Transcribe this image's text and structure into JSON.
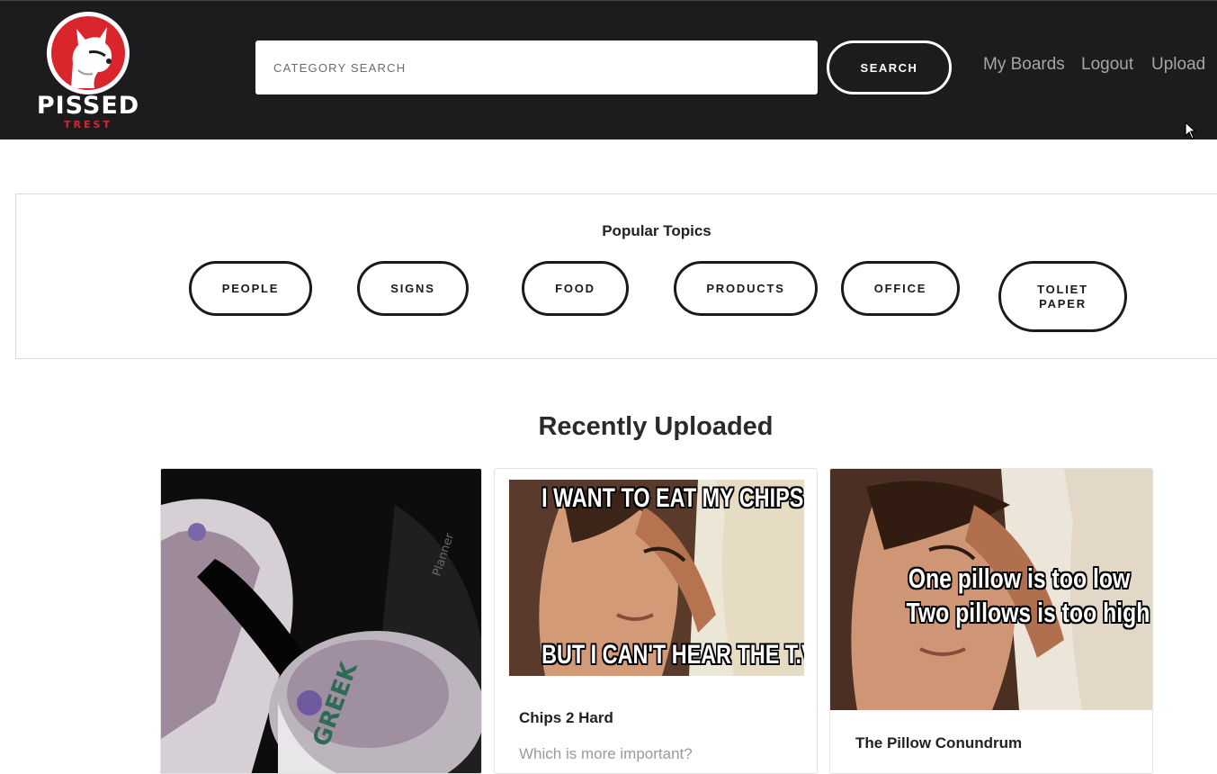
{
  "header": {
    "logo": {
      "word": "PISSED",
      "sub": "TREST"
    },
    "search": {
      "placeholder": "CATEGORY SEARCH",
      "button_label": "SEARCH"
    },
    "nav": [
      {
        "label": "My Boards"
      },
      {
        "label": "Logout"
      },
      {
        "label": "Upload"
      }
    ]
  },
  "topics": {
    "title": "Popular Topics",
    "items": [
      {
        "label": "PEOPLE"
      },
      {
        "label": "SIGNS"
      },
      {
        "label": "FOOD"
      },
      {
        "label": "PRODUCTS"
      },
      {
        "label": "OFFICE"
      },
      {
        "label": "TOLIET PAPER"
      }
    ]
  },
  "recent": {
    "title": "Recently Uploaded",
    "cards": [
      {
        "title": "",
        "description": "",
        "image": "yogurt-photo"
      },
      {
        "title": "Chips 2 Hard",
        "description": "Which is more important?",
        "image": "meme-photo",
        "meme_top": "I WANT TO EAT MY CHIPS",
        "meme_bottom": "BUT I CAN'T HEAR THE T.V."
      },
      {
        "title": "The Pillow Conundrum",
        "description": "",
        "image": "meme-photo",
        "meme_line1": "One pillow is too low",
        "meme_line2": "Two pillows is too high"
      }
    ]
  },
  "colors": {
    "header_bg": "#1c1c1e",
    "brand_red": "#d8262c",
    "nav_text": "#a6a6a6"
  }
}
